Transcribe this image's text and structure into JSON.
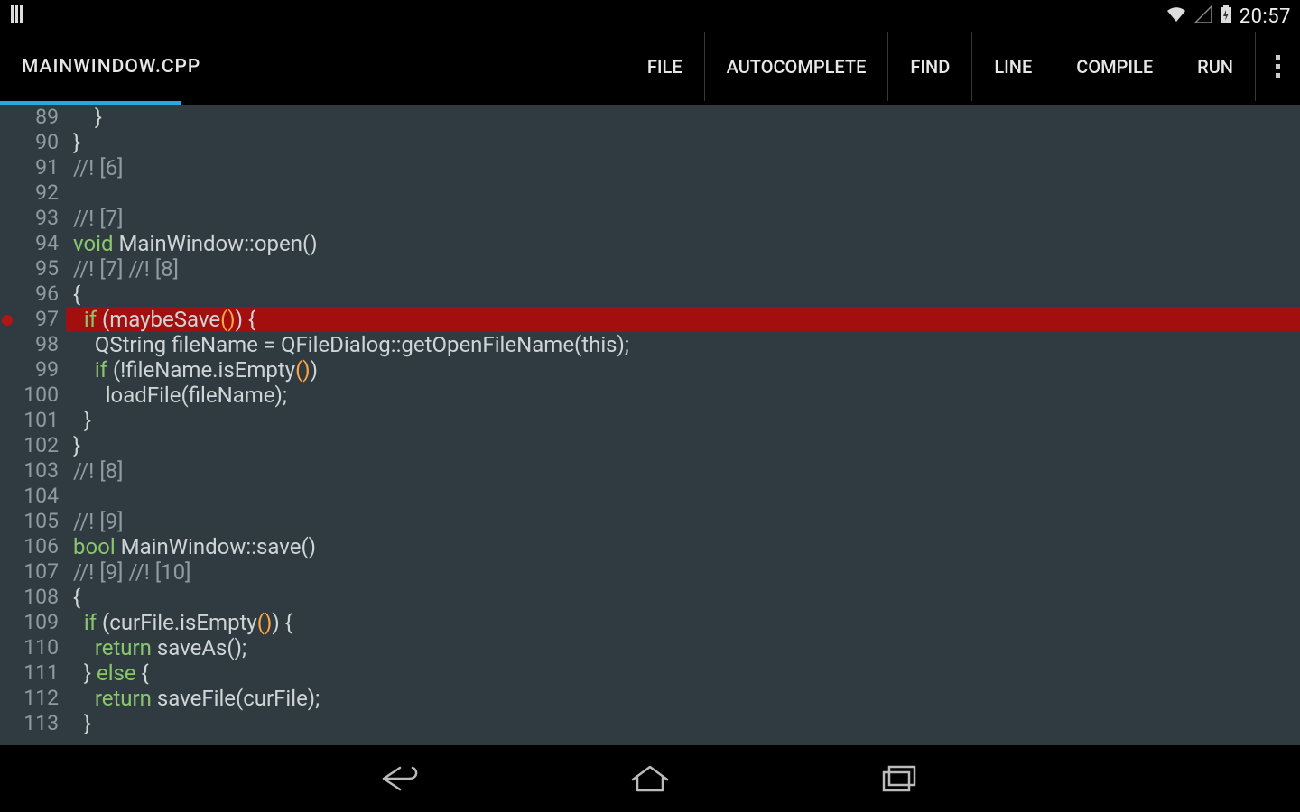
{
  "statusbar": {
    "clock": "20:57"
  },
  "appbar": {
    "title": "MAINWINDOW.CPP",
    "menu": [
      "FILE",
      "AUTOCOMPLETE",
      "FIND",
      "LINE",
      "COMPILE",
      "RUN"
    ]
  },
  "editor": {
    "first_line_no": 89,
    "breakpoint_line": 97,
    "lines": [
      {
        "n": 89,
        "tokens": [
          {
            "t": "    }",
            "c": "dflt"
          }
        ]
      },
      {
        "n": 90,
        "tokens": [
          {
            "t": "}",
            "c": "dflt"
          }
        ]
      },
      {
        "n": 91,
        "tokens": [
          {
            "t": "//! [6]",
            "c": "cm"
          }
        ]
      },
      {
        "n": 92,
        "tokens": [
          {
            "t": "",
            "c": "dflt"
          }
        ]
      },
      {
        "n": 93,
        "tokens": [
          {
            "t": "//! [7]",
            "c": "cm"
          }
        ]
      },
      {
        "n": 94,
        "tokens": [
          {
            "t": "void",
            "c": "kw"
          },
          {
            "t": " MainWindow::open()",
            "c": "dflt"
          }
        ]
      },
      {
        "n": 95,
        "tokens": [
          {
            "t": "//! [7] //! [8]",
            "c": "cm"
          }
        ]
      },
      {
        "n": 96,
        "tokens": [
          {
            "t": "{",
            "c": "dflt"
          }
        ]
      },
      {
        "n": 97,
        "err": true,
        "tokens": [
          {
            "t": "  ",
            "c": "dflt"
          },
          {
            "t": "if",
            "c": "kw"
          },
          {
            "t": " (maybeSave",
            "c": "dflt"
          },
          {
            "t": "()",
            "c": "pn"
          },
          {
            "t": ") {",
            "c": "dflt"
          }
        ]
      },
      {
        "n": 98,
        "tokens": [
          {
            "t": "    QString fileName = QFileDialog::getOpenFileName(this);",
            "c": "dflt"
          }
        ]
      },
      {
        "n": 99,
        "tokens": [
          {
            "t": "    ",
            "c": "dflt"
          },
          {
            "t": "if",
            "c": "kw"
          },
          {
            "t": " (!fileName.isEmpty",
            "c": "dflt"
          },
          {
            "t": "()",
            "c": "pn"
          },
          {
            "t": ")",
            "c": "dflt"
          }
        ]
      },
      {
        "n": 100,
        "tokens": [
          {
            "t": "      loadFile(fileName);",
            "c": "dflt"
          }
        ]
      },
      {
        "n": 101,
        "tokens": [
          {
            "t": "  }",
            "c": "dflt"
          }
        ]
      },
      {
        "n": 102,
        "tokens": [
          {
            "t": "}",
            "c": "dflt"
          }
        ]
      },
      {
        "n": 103,
        "tokens": [
          {
            "t": "//! [8]",
            "c": "cm"
          }
        ]
      },
      {
        "n": 104,
        "tokens": [
          {
            "t": "",
            "c": "dflt"
          }
        ]
      },
      {
        "n": 105,
        "tokens": [
          {
            "t": "//! [9]",
            "c": "cm"
          }
        ]
      },
      {
        "n": 106,
        "tokens": [
          {
            "t": "bool",
            "c": "kw"
          },
          {
            "t": " MainWindow::save()",
            "c": "dflt"
          }
        ]
      },
      {
        "n": 107,
        "tokens": [
          {
            "t": "//! [9] //! [10]",
            "c": "cm"
          }
        ]
      },
      {
        "n": 108,
        "tokens": [
          {
            "t": "{",
            "c": "dflt"
          }
        ]
      },
      {
        "n": 109,
        "tokens": [
          {
            "t": "  ",
            "c": "dflt"
          },
          {
            "t": "if",
            "c": "kw"
          },
          {
            "t": " (curFile.isEmpty",
            "c": "dflt"
          },
          {
            "t": "()",
            "c": "pn"
          },
          {
            "t": ") {",
            "c": "dflt"
          }
        ]
      },
      {
        "n": 110,
        "tokens": [
          {
            "t": "    ",
            "c": "dflt"
          },
          {
            "t": "return",
            "c": "kw"
          },
          {
            "t": " saveAs();",
            "c": "dflt"
          }
        ]
      },
      {
        "n": 111,
        "tokens": [
          {
            "t": "  } ",
            "c": "dflt"
          },
          {
            "t": "else",
            "c": "kw"
          },
          {
            "t": " {",
            "c": "dflt"
          }
        ]
      },
      {
        "n": 112,
        "tokens": [
          {
            "t": "    ",
            "c": "dflt"
          },
          {
            "t": "return",
            "c": "kw"
          },
          {
            "t": " saveFile(curFile);",
            "c": "dflt"
          }
        ]
      },
      {
        "n": 113,
        "tokens": [
          {
            "t": "  }",
            "c": "dflt"
          }
        ]
      }
    ]
  }
}
